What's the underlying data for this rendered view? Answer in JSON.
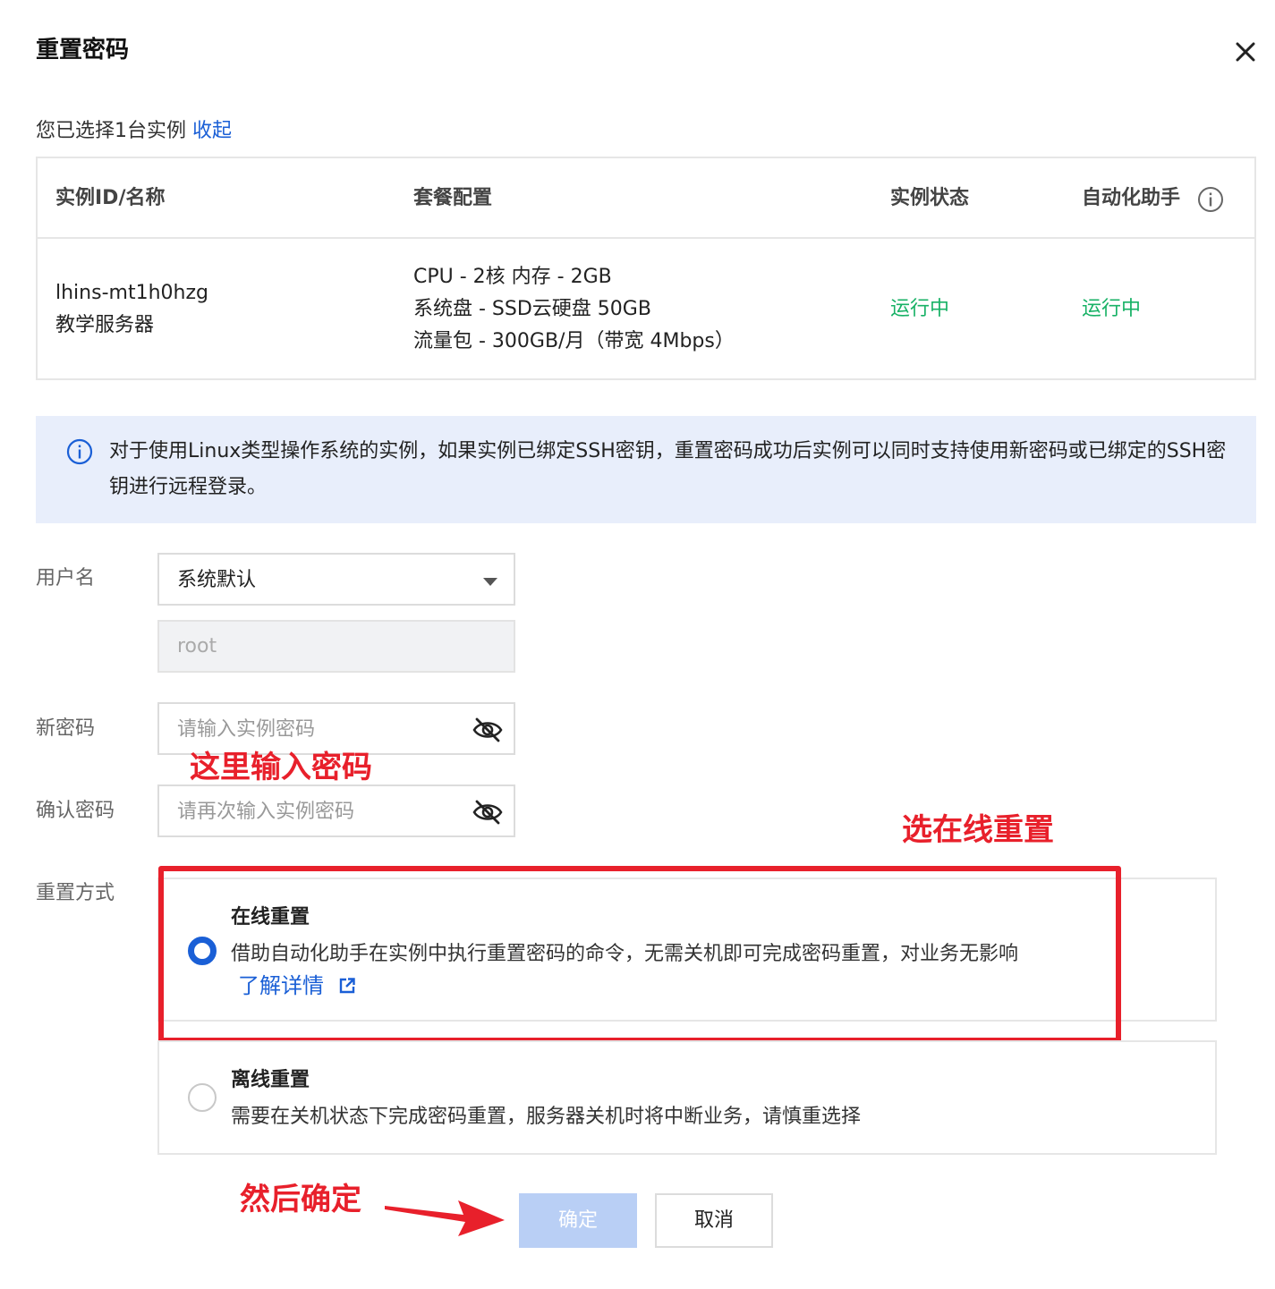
{
  "dialog": {
    "title": "重置密码",
    "close_icon": "close-icon"
  },
  "selection": {
    "text": "您已选择1台实例",
    "collapse_link": "收起"
  },
  "table": {
    "headers": [
      "实例ID/名称",
      "套餐配置",
      "实例状态",
      "自动化助手"
    ],
    "info_icon": "info-circle-icon",
    "row": {
      "instance_id": "lhins-mt1h0hzg",
      "instance_name": "教学服务器",
      "config": [
        "CPU - 2核 内存 - 2GB",
        "系统盘 - SSD云硬盘 50GB",
        "流量包 - 300GB/月（带宽 4Mbps）"
      ],
      "status": "运行中",
      "automation": "运行中"
    }
  },
  "notice": {
    "icon": "info-circle-icon",
    "text": "对于使用Linux类型操作系统的实例，如果实例已绑定SSH密钥，重置密码成功后实例可以同时支持使用新密码或已绑定的SSH密钥进行远程登录。"
  },
  "form": {
    "username_label": "用户名",
    "username_select_value": "系统默认",
    "username_value": "root",
    "new_password_label": "新密码",
    "new_password_placeholder": "请输入实例密码",
    "confirm_password_label": "确认密码",
    "confirm_password_placeholder": "请再次输入实例密码",
    "reset_method_label": "重置方式",
    "options": [
      {
        "title": "在线重置",
        "desc": "借助自动化助手在实例中执行重置密码的命令，无需关机即可完成密码重置，对业务无影响",
        "link": "了解详情",
        "selected": true
      },
      {
        "title": "离线重置",
        "desc": "需要在关机状态下完成密码重置，服务器关机时将中断业务，请慎重选择",
        "selected": false
      }
    ]
  },
  "buttons": {
    "ok": "确定",
    "cancel": "取消"
  },
  "annotations": {
    "enter_password": "这里输入密码",
    "choose_online": "选在线重置",
    "then_confirm": "然后确定",
    "color": "#e8202b"
  },
  "colors": {
    "link": "#1a5fd6",
    "status_green": "#18b266",
    "notice_bg": "#e8eefb",
    "ok_button_disabled": "#b9cff5"
  }
}
